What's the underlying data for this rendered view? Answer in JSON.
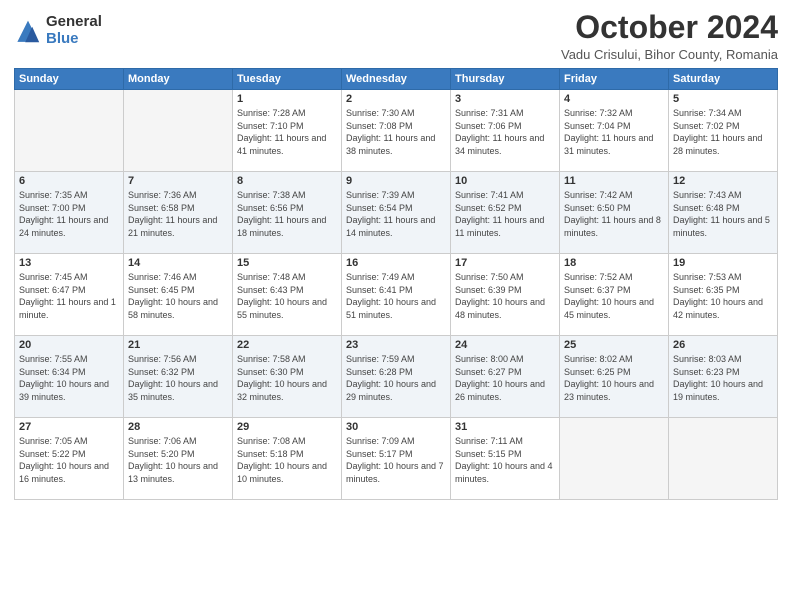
{
  "logo": {
    "general": "General",
    "blue": "Blue"
  },
  "header": {
    "month": "October 2024",
    "location": "Vadu Crisului, Bihor County, Romania"
  },
  "weekdays": [
    "Sunday",
    "Monday",
    "Tuesday",
    "Wednesday",
    "Thursday",
    "Friday",
    "Saturday"
  ],
  "weeks": [
    [
      {
        "day": "",
        "sunrise": "",
        "sunset": "",
        "daylight": "",
        "empty": true
      },
      {
        "day": "",
        "sunrise": "",
        "sunset": "",
        "daylight": "",
        "empty": true
      },
      {
        "day": "1",
        "sunrise": "Sunrise: 7:28 AM",
        "sunset": "Sunset: 7:10 PM",
        "daylight": "Daylight: 11 hours and 41 minutes.",
        "empty": false
      },
      {
        "day": "2",
        "sunrise": "Sunrise: 7:30 AM",
        "sunset": "Sunset: 7:08 PM",
        "daylight": "Daylight: 11 hours and 38 minutes.",
        "empty": false
      },
      {
        "day": "3",
        "sunrise": "Sunrise: 7:31 AM",
        "sunset": "Sunset: 7:06 PM",
        "daylight": "Daylight: 11 hours and 34 minutes.",
        "empty": false
      },
      {
        "day": "4",
        "sunrise": "Sunrise: 7:32 AM",
        "sunset": "Sunset: 7:04 PM",
        "daylight": "Daylight: 11 hours and 31 minutes.",
        "empty": false
      },
      {
        "day": "5",
        "sunrise": "Sunrise: 7:34 AM",
        "sunset": "Sunset: 7:02 PM",
        "daylight": "Daylight: 11 hours and 28 minutes.",
        "empty": false
      }
    ],
    [
      {
        "day": "6",
        "sunrise": "Sunrise: 7:35 AM",
        "sunset": "Sunset: 7:00 PM",
        "daylight": "Daylight: 11 hours and 24 minutes.",
        "empty": false
      },
      {
        "day": "7",
        "sunrise": "Sunrise: 7:36 AM",
        "sunset": "Sunset: 6:58 PM",
        "daylight": "Daylight: 11 hours and 21 minutes.",
        "empty": false
      },
      {
        "day": "8",
        "sunrise": "Sunrise: 7:38 AM",
        "sunset": "Sunset: 6:56 PM",
        "daylight": "Daylight: 11 hours and 18 minutes.",
        "empty": false
      },
      {
        "day": "9",
        "sunrise": "Sunrise: 7:39 AM",
        "sunset": "Sunset: 6:54 PM",
        "daylight": "Daylight: 11 hours and 14 minutes.",
        "empty": false
      },
      {
        "day": "10",
        "sunrise": "Sunrise: 7:41 AM",
        "sunset": "Sunset: 6:52 PM",
        "daylight": "Daylight: 11 hours and 11 minutes.",
        "empty": false
      },
      {
        "day": "11",
        "sunrise": "Sunrise: 7:42 AM",
        "sunset": "Sunset: 6:50 PM",
        "daylight": "Daylight: 11 hours and 8 minutes.",
        "empty": false
      },
      {
        "day": "12",
        "sunrise": "Sunrise: 7:43 AM",
        "sunset": "Sunset: 6:48 PM",
        "daylight": "Daylight: 11 hours and 5 minutes.",
        "empty": false
      }
    ],
    [
      {
        "day": "13",
        "sunrise": "Sunrise: 7:45 AM",
        "sunset": "Sunset: 6:47 PM",
        "daylight": "Daylight: 11 hours and 1 minute.",
        "empty": false
      },
      {
        "day": "14",
        "sunrise": "Sunrise: 7:46 AM",
        "sunset": "Sunset: 6:45 PM",
        "daylight": "Daylight: 10 hours and 58 minutes.",
        "empty": false
      },
      {
        "day": "15",
        "sunrise": "Sunrise: 7:48 AM",
        "sunset": "Sunset: 6:43 PM",
        "daylight": "Daylight: 10 hours and 55 minutes.",
        "empty": false
      },
      {
        "day": "16",
        "sunrise": "Sunrise: 7:49 AM",
        "sunset": "Sunset: 6:41 PM",
        "daylight": "Daylight: 10 hours and 51 minutes.",
        "empty": false
      },
      {
        "day": "17",
        "sunrise": "Sunrise: 7:50 AM",
        "sunset": "Sunset: 6:39 PM",
        "daylight": "Daylight: 10 hours and 48 minutes.",
        "empty": false
      },
      {
        "day": "18",
        "sunrise": "Sunrise: 7:52 AM",
        "sunset": "Sunset: 6:37 PM",
        "daylight": "Daylight: 10 hours and 45 minutes.",
        "empty": false
      },
      {
        "day": "19",
        "sunrise": "Sunrise: 7:53 AM",
        "sunset": "Sunset: 6:35 PM",
        "daylight": "Daylight: 10 hours and 42 minutes.",
        "empty": false
      }
    ],
    [
      {
        "day": "20",
        "sunrise": "Sunrise: 7:55 AM",
        "sunset": "Sunset: 6:34 PM",
        "daylight": "Daylight: 10 hours and 39 minutes.",
        "empty": false
      },
      {
        "day": "21",
        "sunrise": "Sunrise: 7:56 AM",
        "sunset": "Sunset: 6:32 PM",
        "daylight": "Daylight: 10 hours and 35 minutes.",
        "empty": false
      },
      {
        "day": "22",
        "sunrise": "Sunrise: 7:58 AM",
        "sunset": "Sunset: 6:30 PM",
        "daylight": "Daylight: 10 hours and 32 minutes.",
        "empty": false
      },
      {
        "day": "23",
        "sunrise": "Sunrise: 7:59 AM",
        "sunset": "Sunset: 6:28 PM",
        "daylight": "Daylight: 10 hours and 29 minutes.",
        "empty": false
      },
      {
        "day": "24",
        "sunrise": "Sunrise: 8:00 AM",
        "sunset": "Sunset: 6:27 PM",
        "daylight": "Daylight: 10 hours and 26 minutes.",
        "empty": false
      },
      {
        "day": "25",
        "sunrise": "Sunrise: 8:02 AM",
        "sunset": "Sunset: 6:25 PM",
        "daylight": "Daylight: 10 hours and 23 minutes.",
        "empty": false
      },
      {
        "day": "26",
        "sunrise": "Sunrise: 8:03 AM",
        "sunset": "Sunset: 6:23 PM",
        "daylight": "Daylight: 10 hours and 19 minutes.",
        "empty": false
      }
    ],
    [
      {
        "day": "27",
        "sunrise": "Sunrise: 7:05 AM",
        "sunset": "Sunset: 5:22 PM",
        "daylight": "Daylight: 10 hours and 16 minutes.",
        "empty": false
      },
      {
        "day": "28",
        "sunrise": "Sunrise: 7:06 AM",
        "sunset": "Sunset: 5:20 PM",
        "daylight": "Daylight: 10 hours and 13 minutes.",
        "empty": false
      },
      {
        "day": "29",
        "sunrise": "Sunrise: 7:08 AM",
        "sunset": "Sunset: 5:18 PM",
        "daylight": "Daylight: 10 hours and 10 minutes.",
        "empty": false
      },
      {
        "day": "30",
        "sunrise": "Sunrise: 7:09 AM",
        "sunset": "Sunset: 5:17 PM",
        "daylight": "Daylight: 10 hours and 7 minutes.",
        "empty": false
      },
      {
        "day": "31",
        "sunrise": "Sunrise: 7:11 AM",
        "sunset": "Sunset: 5:15 PM",
        "daylight": "Daylight: 10 hours and 4 minutes.",
        "empty": false
      },
      {
        "day": "",
        "sunrise": "",
        "sunset": "",
        "daylight": "",
        "empty": true
      },
      {
        "day": "",
        "sunrise": "",
        "sunset": "",
        "daylight": "",
        "empty": true
      }
    ]
  ]
}
